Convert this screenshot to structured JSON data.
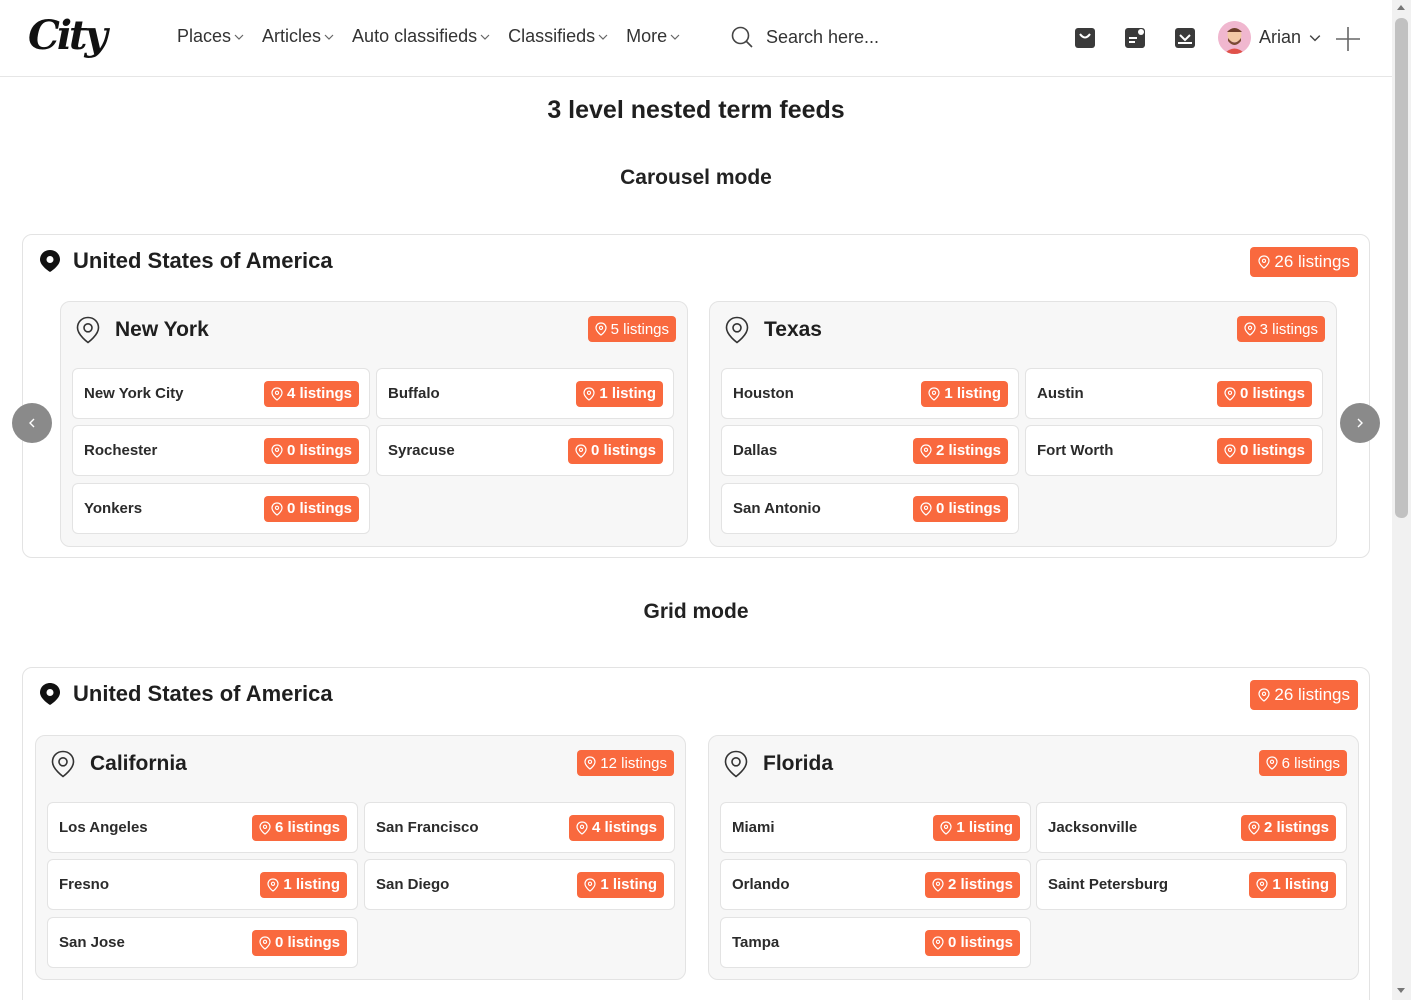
{
  "header": {
    "logo": "City",
    "nav": [
      {
        "label": "Places"
      },
      {
        "label": "Articles"
      },
      {
        "label": "Auto classifieds"
      },
      {
        "label": "Classifieds"
      },
      {
        "label": "More"
      }
    ],
    "search_placeholder": "Search here...",
    "user_name": "Arian"
  },
  "page": {
    "title": "3 level nested term feeds",
    "carousel_title": "Carousel mode",
    "grid_title": "Grid mode"
  },
  "carousel": {
    "country": "United States of America",
    "country_count": "26 listings",
    "states": [
      {
        "name": "New York",
        "count": "5 listings",
        "cities": [
          {
            "name": "New York City",
            "count": "4 listings"
          },
          {
            "name": "Buffalo",
            "count": "1 listing"
          },
          {
            "name": "Rochester",
            "count": "0 listings"
          },
          {
            "name": "Syracuse",
            "count": "0 listings"
          },
          {
            "name": "Yonkers",
            "count": "0 listings"
          }
        ]
      },
      {
        "name": "Texas",
        "count": "3 listings",
        "cities": [
          {
            "name": "Houston",
            "count": "1 listing"
          },
          {
            "name": "Austin",
            "count": "0 listings"
          },
          {
            "name": "Dallas",
            "count": "2 listings"
          },
          {
            "name": "Fort Worth",
            "count": "0 listings"
          },
          {
            "name": "San Antonio",
            "count": "0 listings"
          }
        ]
      }
    ]
  },
  "grid": {
    "country": "United States of America",
    "country_count": "26 listings",
    "states": [
      {
        "name": "California",
        "count": "12 listings",
        "cities": [
          {
            "name": "Los Angeles",
            "count": "6 listings"
          },
          {
            "name": "San Francisco",
            "count": "4 listings"
          },
          {
            "name": "Fresno",
            "count": "1 listing"
          },
          {
            "name": "San Diego",
            "count": "1 listing"
          },
          {
            "name": "San Jose",
            "count": "0 listings"
          }
        ]
      },
      {
        "name": "Florida",
        "count": "6 listings",
        "cities": [
          {
            "name": "Miami",
            "count": "1 listing"
          },
          {
            "name": "Jacksonville",
            "count": "2 listings"
          },
          {
            "name": "Orlando",
            "count": "2 listings"
          },
          {
            "name": "Saint Petersburg",
            "count": "1 listing"
          },
          {
            "name": "Tampa",
            "count": "0 listings"
          }
        ]
      }
    ]
  },
  "colors": {
    "accent": "#f9693e",
    "card_bg": "#f7f7f7",
    "border": "#e3e3e3"
  }
}
